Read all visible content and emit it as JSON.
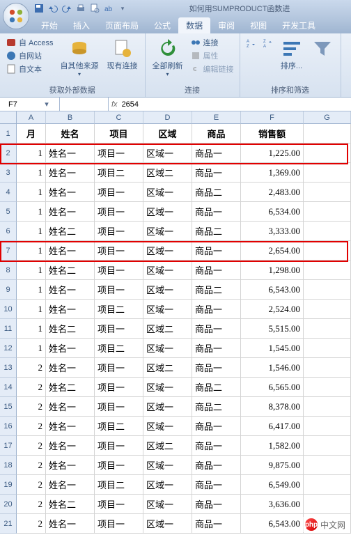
{
  "title": "如何用SUMPRODUCT函数进",
  "qat_icons": [
    "save-icon",
    "undo-icon",
    "redo-icon",
    "print-icon",
    "preview-icon",
    "spell-icon"
  ],
  "tabs": [
    "开始",
    "插入",
    "页面布局",
    "公式",
    "数据",
    "审阅",
    "视图",
    "开发工具"
  ],
  "active_tab": 4,
  "ribbon": {
    "group_ext": {
      "access": "自 Access",
      "web": "自网站",
      "text": "自文本",
      "other_top": "自其他来源",
      "existing": "现有连接",
      "label": "获取外部数据"
    },
    "group_conn": {
      "refresh": "全部刷新",
      "connections": "连接",
      "properties": "属性",
      "editlinks": "编辑链接",
      "label": "连接"
    },
    "group_sort": {
      "sort": "排序...",
      "filter": "",
      "label": "排序和筛选"
    }
  },
  "namebox": "F7",
  "formula_prefix": "fx",
  "formula_value": "2654",
  "columns": [
    "A",
    "B",
    "C",
    "D",
    "E",
    "F",
    "G"
  ],
  "headers": {
    "A": "月",
    "B": "姓名",
    "C": "项目",
    "D": "区域",
    "E": "商品",
    "F": "销售额"
  },
  "rows": [
    {
      "n": 2,
      "A": "1",
      "B": "姓名一",
      "C": "项目一",
      "D": "区域一",
      "E": "商品一",
      "F": "1,225.00"
    },
    {
      "n": 3,
      "A": "1",
      "B": "姓名一",
      "C": "项目二",
      "D": "区域二",
      "E": "商品一",
      "F": "1,369.00"
    },
    {
      "n": 4,
      "A": "1",
      "B": "姓名一",
      "C": "项目一",
      "D": "区域一",
      "E": "商品二",
      "F": "2,483.00"
    },
    {
      "n": 5,
      "A": "1",
      "B": "姓名一",
      "C": "项目一",
      "D": "区域一",
      "E": "商品一",
      "F": "6,534.00"
    },
    {
      "n": 6,
      "A": "1",
      "B": "姓名二",
      "C": "项目一",
      "D": "区域一",
      "E": "商品二",
      "F": "3,333.00"
    },
    {
      "n": 7,
      "A": "1",
      "B": "姓名一",
      "C": "项目一",
      "D": "区域一",
      "E": "商品一",
      "F": "2,654.00"
    },
    {
      "n": 8,
      "A": "1",
      "B": "姓名二",
      "C": "项目一",
      "D": "区域一",
      "E": "商品一",
      "F": "1,298.00"
    },
    {
      "n": 9,
      "A": "1",
      "B": "姓名一",
      "C": "项目一",
      "D": "区域一",
      "E": "商品二",
      "F": "6,543.00"
    },
    {
      "n": 10,
      "A": "1",
      "B": "姓名一",
      "C": "项目二",
      "D": "区域一",
      "E": "商品一",
      "F": "2,524.00"
    },
    {
      "n": 11,
      "A": "1",
      "B": "姓名二",
      "C": "项目一",
      "D": "区域二",
      "E": "商品一",
      "F": "5,515.00"
    },
    {
      "n": 12,
      "A": "1",
      "B": "姓名一",
      "C": "项目二",
      "D": "区域一",
      "E": "商品一",
      "F": "1,545.00"
    },
    {
      "n": 13,
      "A": "2",
      "B": "姓名一",
      "C": "项目一",
      "D": "区域二",
      "E": "商品一",
      "F": "1,546.00"
    },
    {
      "n": 14,
      "A": "2",
      "B": "姓名二",
      "C": "项目一",
      "D": "区域一",
      "E": "商品二",
      "F": "6,565.00"
    },
    {
      "n": 15,
      "A": "2",
      "B": "姓名一",
      "C": "项目一",
      "D": "区域一",
      "E": "商品二",
      "F": "8,378.00"
    },
    {
      "n": 16,
      "A": "2",
      "B": "姓名一",
      "C": "项目二",
      "D": "区域一",
      "E": "商品一",
      "F": "6,417.00"
    },
    {
      "n": 17,
      "A": "2",
      "B": "姓名一",
      "C": "项目一",
      "D": "区域二",
      "E": "商品一",
      "F": "1,582.00"
    },
    {
      "n": 18,
      "A": "2",
      "B": "姓名一",
      "C": "项目一",
      "D": "区域一",
      "E": "商品一",
      "F": "9,875.00"
    },
    {
      "n": 19,
      "A": "2",
      "B": "姓名一",
      "C": "项目二",
      "D": "区域一",
      "E": "商品一",
      "F": "6,549.00"
    },
    {
      "n": 20,
      "A": "2",
      "B": "姓名二",
      "C": "项目一",
      "D": "区域一",
      "E": "商品一",
      "F": "3,636.00"
    },
    {
      "n": 21,
      "A": "2",
      "B": "姓名一",
      "C": "项目一",
      "D": "区域一",
      "E": "商品一",
      "F": "6,543.00"
    }
  ],
  "highlight_rows": [
    2,
    7
  ],
  "watermark": "中文网"
}
